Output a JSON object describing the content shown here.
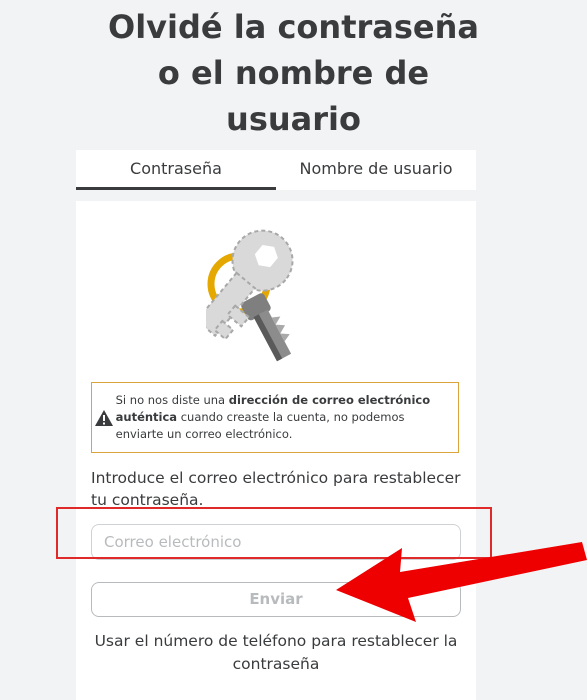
{
  "page": {
    "title_lines": [
      "Olvidé la contraseña",
      "o el nombre de",
      "usuario"
    ]
  },
  "tabs": [
    {
      "label": "Contraseña",
      "active": true
    },
    {
      "label": "Nombre de usuario",
      "active": false
    }
  ],
  "illustration": {
    "icon": "key-icon"
  },
  "warning": {
    "icon": "warning-triangle-icon",
    "text_before": "Si no nos diste una ",
    "text_bold": "dirección de correo electrónico auténtica",
    "text_after": " cuando creaste la cuenta, no podemos enviarte un correo electrónico."
  },
  "form": {
    "instructions": "Introduce el correo electrónico para restablecer tu contraseña.",
    "email_placeholder": "Correo electrónico",
    "email_value": "",
    "submit_label": "Enviar",
    "phone_link": "Usar el número de teléfono para restablecer la contraseña"
  },
  "colors": {
    "background": "#f2f3f4",
    "text": "#393b3d",
    "warning_border": "#d9a43a",
    "annotation_red": "#e02a2a"
  }
}
